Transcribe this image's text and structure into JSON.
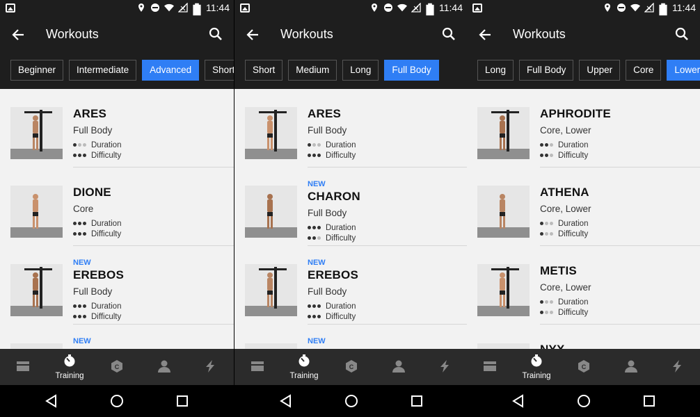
{
  "status": {
    "time": "11:44"
  },
  "panels": [
    {
      "title": "Workouts",
      "chips": [
        {
          "label": "Beginner",
          "active": false
        },
        {
          "label": "Intermediate",
          "active": false
        },
        {
          "label": "Advanced",
          "active": true
        },
        {
          "label": "Short  dvanced",
          "active": false
        }
      ],
      "items": [
        {
          "name": "ARES",
          "category": "Full Body",
          "is_new": false,
          "duration": 1,
          "difficulty": 3
        },
        {
          "name": "DIONE",
          "category": "Core",
          "is_new": false,
          "duration": 3,
          "difficulty": 3
        },
        {
          "name": "EREBOS",
          "category": "Full Body",
          "is_new": true,
          "duration": 3,
          "difficulty": 3
        },
        {
          "name": "",
          "category": "",
          "is_new": true,
          "duration": 0,
          "difficulty": 0
        }
      ]
    },
    {
      "title": "Workouts",
      "chips": [
        {
          "label": "Short",
          "active": false
        },
        {
          "label": "Medium",
          "active": false
        },
        {
          "label": "Long",
          "active": false
        },
        {
          "label": "Full Body",
          "active": true
        }
      ],
      "items": [
        {
          "name": "ARES",
          "category": "Full Body",
          "is_new": false,
          "duration": 1,
          "difficulty": 3
        },
        {
          "name": "CHARON",
          "category": "Full Body",
          "is_new": true,
          "duration": 3,
          "difficulty": 2
        },
        {
          "name": "EREBOS",
          "category": "Full Body",
          "is_new": true,
          "duration": 3,
          "difficulty": 3
        },
        {
          "name": "",
          "category": "",
          "is_new": true,
          "duration": 0,
          "difficulty": 0
        }
      ]
    },
    {
      "title": "Workouts",
      "chips": [
        {
          "label": "Long",
          "active": false
        },
        {
          "label": "Full Body",
          "active": false
        },
        {
          "label": "Upper",
          "active": false
        },
        {
          "label": "Core",
          "active": false
        },
        {
          "label": "Lower",
          "active": true
        }
      ],
      "items": [
        {
          "name": "APHRODITE",
          "category": "Core, Lower",
          "is_new": false,
          "duration": 2,
          "difficulty": 2
        },
        {
          "name": "ATHENA",
          "category": "Core, Lower",
          "is_new": false,
          "duration": 1,
          "difficulty": 1
        },
        {
          "name": "METIS",
          "category": "Core, Lower",
          "is_new": false,
          "duration": 1,
          "difficulty": 1
        },
        {
          "name": "NYX",
          "category": "",
          "is_new": false,
          "duration": 0,
          "difficulty": 0
        }
      ]
    }
  ],
  "labels": {
    "duration": "Duration",
    "difficulty": "Difficulty",
    "new": "NEW"
  },
  "bottom_nav": [
    {
      "icon": "feed-icon",
      "label": ""
    },
    {
      "icon": "training-stopwatch-icon",
      "label": "Training",
      "active": true
    },
    {
      "icon": "coach-icon",
      "label": ""
    },
    {
      "icon": "profile-icon",
      "label": ""
    },
    {
      "icon": "lightning-icon",
      "label": ""
    }
  ],
  "colors": {
    "accent": "#2f7ef5",
    "bar": "#1e1e1e",
    "nav": "#2b2b2b"
  }
}
